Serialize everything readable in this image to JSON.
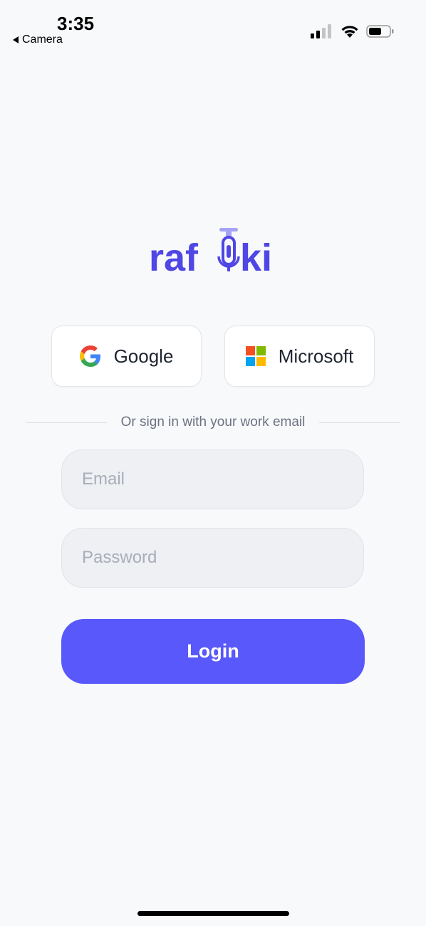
{
  "status_bar": {
    "time": "3:35",
    "back_app": "Camera",
    "icons": [
      "signal-icon",
      "wifi-icon",
      "battery-icon"
    ]
  },
  "brand": {
    "logo_text": "rafiki",
    "color": "#4f46e5"
  },
  "social": {
    "google_label": "Google",
    "microsoft_label": "Microsoft"
  },
  "divider_text": "Or sign in with your work email",
  "form": {
    "email": {
      "value": "",
      "placeholder": "Email"
    },
    "password": {
      "value": "",
      "placeholder": "Password"
    },
    "login_label": "Login"
  },
  "colors": {
    "accent": "#5858fb",
    "background": "#f8f9fb",
    "field_bg": "#eef0f4"
  }
}
